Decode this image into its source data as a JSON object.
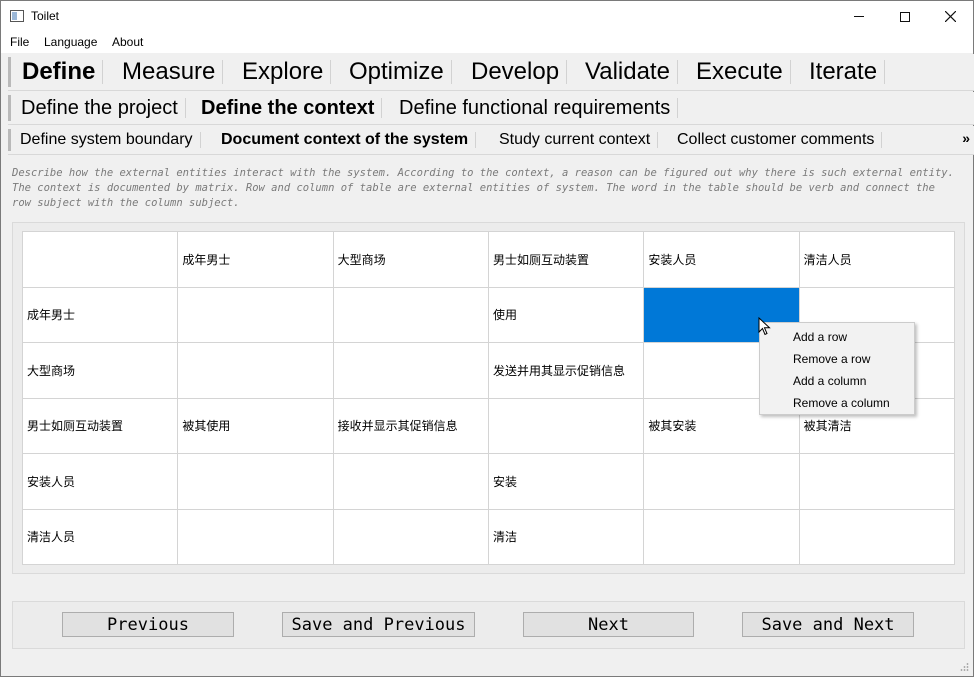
{
  "window": {
    "title": "Toilet"
  },
  "menu": {
    "items": [
      "File",
      "Language",
      "About"
    ]
  },
  "nav_level1": {
    "tabs": [
      "Define",
      "Measure",
      "Explore",
      "Optimize",
      "Develop",
      "Validate",
      "Execute",
      "Iterate"
    ],
    "active": "Define"
  },
  "nav_level2": {
    "tabs": [
      "Define the project",
      "Define the context",
      "Define functional requirements"
    ],
    "active": "Define the context"
  },
  "nav_level3": {
    "tabs": [
      "Define system boundary",
      "Document context of the system",
      "Study current context",
      "Collect customer comments"
    ],
    "active": "Document context of the system",
    "more": "»"
  },
  "description": "Describe how the external entities interact with the system. According to the context, a reason can be figured out why there is such external entity. The context is documented by matrix. Row and column of table are external entities of system. The word in the table should be verb and connect the row subject with the column subject.",
  "matrix": {
    "rows": [
      [
        "",
        "成年男士",
        "大型商场",
        "男士如厕互动装置",
        "安装人员",
        "清洁人员"
      ],
      [
        "成年男士",
        "",
        "",
        "使用",
        "",
        ""
      ],
      [
        "大型商场",
        "",
        "",
        "发送并用其显示促销信息",
        "",
        ""
      ],
      [
        "男士如厕互动装置",
        "被其使用",
        "接收并显示其促销信息",
        "",
        "被其安装",
        "被其清洁"
      ],
      [
        "安装人员",
        "",
        "",
        "安装",
        "",
        ""
      ],
      [
        "清洁人员",
        "",
        "",
        "清洁",
        "",
        ""
      ]
    ],
    "selected_cell": "row 1, column 4"
  },
  "context_menu": {
    "items": [
      "Add a row",
      "Remove a row",
      "Add a column",
      "Remove a column"
    ]
  },
  "buttons": {
    "previous": "Previous",
    "save_previous": "Save and Previous",
    "next": "Next",
    "save_next": "Save and Next"
  },
  "colors": {
    "selection": "#0078d7",
    "window_bg": "#f0f0f0"
  },
  "icons": {
    "app": "app-window-icon",
    "cursor": "mouse-pointer-icon",
    "more": "chevron-double-right-icon"
  }
}
